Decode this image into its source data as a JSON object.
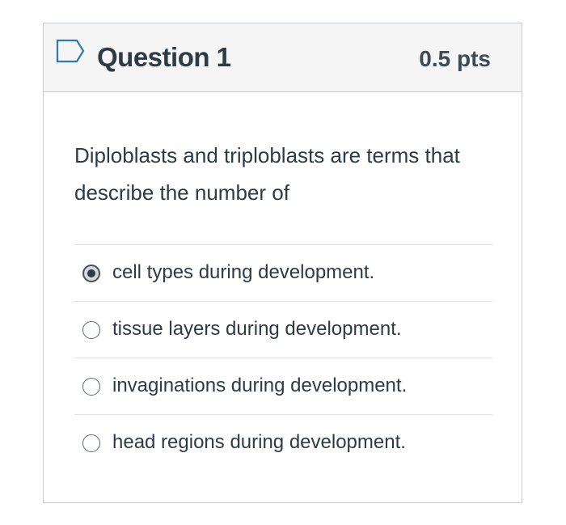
{
  "question": {
    "title": "Question 1",
    "points": "0.5 pts",
    "text": "Diploblasts and triploblasts are terms that describe the number of",
    "flag_icon": "bookmark-flag-icon"
  },
  "answers": [
    {
      "label": "cell types during development.",
      "selected": true
    },
    {
      "label": "tissue layers during development.",
      "selected": false
    },
    {
      "label": "invaginations during development.",
      "selected": false
    },
    {
      "label": "head regions during development.",
      "selected": false
    }
  ],
  "colors": {
    "header_bg": "#f5f5f5",
    "border": "#c7cdd1",
    "text": "#2d3b45",
    "flag_outline": "#2d7bb6"
  }
}
